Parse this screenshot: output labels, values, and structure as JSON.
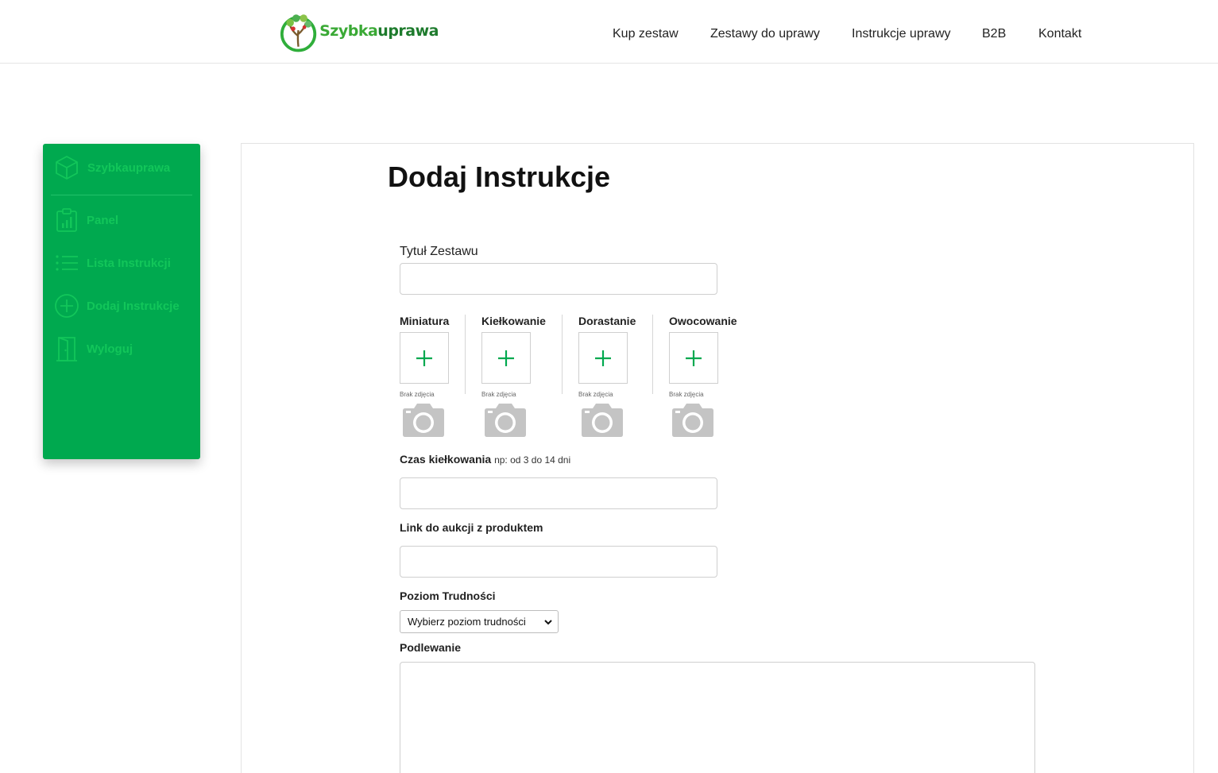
{
  "brand": {
    "logo_text_part1": "Szybka",
    "logo_text_part2": "uprawa",
    "logo_icon": "tree-logo-icon"
  },
  "nav": {
    "items": [
      {
        "label": "Kup zestaw"
      },
      {
        "label": "Zestawy do uprawy"
      },
      {
        "label": "Instrukcje uprawy"
      },
      {
        "label": "B2B"
      },
      {
        "label": "Kontakt"
      }
    ]
  },
  "sidebar": {
    "brand_label": "Szybkauprawa",
    "brand_icon": "cube-icon",
    "items": [
      {
        "label": "Panel",
        "icon": "clipboard-chart-icon"
      },
      {
        "label": "Lista Instrukcji",
        "icon": "list-icon"
      },
      {
        "label": "Dodaj Instrukcje",
        "icon": "plus-circle-icon"
      },
      {
        "label": "Wyloguj",
        "icon": "door-icon"
      }
    ],
    "bg_color": "#00a94f",
    "text_color": "#12c65a"
  },
  "form": {
    "title": "Dodaj Instrukcje",
    "set_title_label": "Tytuł Zestawu",
    "set_title_value": "",
    "images": [
      {
        "label": "Miniatura",
        "no_photo": "Brak zdjęcia"
      },
      {
        "label": "Kiełkowanie",
        "no_photo": "Brak zdjęcia"
      },
      {
        "label": "Dorastanie",
        "no_photo": "Brak zdjęcia"
      },
      {
        "label": "Owocowanie",
        "no_photo": "Brak zdjęcia"
      }
    ],
    "germination_label": "Czas kiełkowania",
    "germination_hint": "np: od 3 do 14 dni",
    "germination_value": "",
    "auction_label": "Link do aukcji z produktem",
    "auction_value": "",
    "difficulty_label": "Poziom Trudności",
    "difficulty_selected": "Wybierz poziom trudności",
    "watering_label": "Podlewanie",
    "watering_value": ""
  },
  "colors": {
    "accent": "#00a94f",
    "plus_icon": "#00a94f",
    "camera_icon": "#c4c4c4"
  }
}
